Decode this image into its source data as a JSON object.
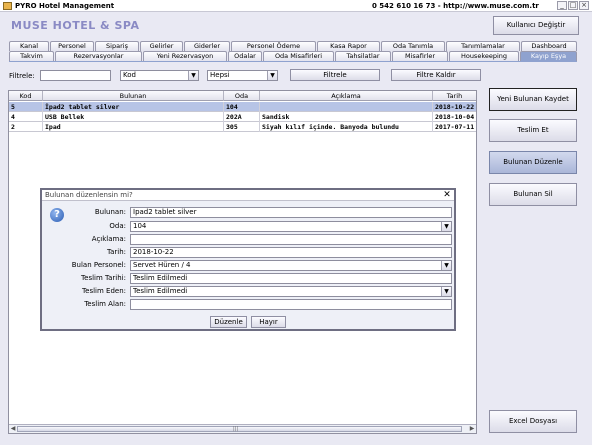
{
  "window": {
    "title": "PYRO Hotel Management",
    "contact": "0 542 610 16 73  -  http://www.muse.com.tr",
    "ctl_min": "_",
    "ctl_max": "□",
    "ctl_close": "×"
  },
  "hotel_name": "MUSE HOTEL & SPA",
  "change_user_label": "Kullanıcı Değiştir",
  "tabs_row1": [
    "Kanal",
    "Personel",
    "Sipariş",
    "Gelirler",
    "Giderler",
    "Personel Ödeme",
    "Kasa Rapor",
    "Oda Tanımla",
    "Tanımlamalar",
    "Dashboard"
  ],
  "tabs_row2": [
    "Takvim",
    "Rezervasyonlar",
    "Yeni Rezervasyon",
    "Odalar",
    "Oda Misafirleri",
    "Tahsilatlar",
    "Misafirler",
    "Housekeeping",
    "Kayıp Eşya"
  ],
  "filter": {
    "label": "Filtrele:",
    "text_value": "",
    "column_value": "Kod",
    "status_value": "Hepsi",
    "filter_button": "Filtrele",
    "clear_button": "Filtre Kaldır"
  },
  "table": {
    "headers": [
      "Kod",
      "Bulunan",
      "Oda",
      "Açıklama",
      "Tarih"
    ],
    "rows": [
      {
        "kod": "5",
        "bulunan": "İpad2 tablet silver",
        "oda": "104",
        "aciklama": "",
        "tarih": "2018-10-22 ...",
        "selected": true
      },
      {
        "kod": "4",
        "bulunan": "USB Bellek",
        "oda": "202A",
        "aciklama": "Sandisk",
        "tarih": "2018-10-04 ...",
        "selected": false
      },
      {
        "kod": "2",
        "bulunan": "Ipad",
        "oda": "305",
        "aciklama": "Siyah kılıf içinde. Banyoda bulundu",
        "tarih": "2017-07-11 ...",
        "selected": false
      }
    ],
    "scroll_left": "◀",
    "scroll_right": "▶",
    "scroll_grip": "|||"
  },
  "side_buttons": {
    "save_new": "Yeni Bulunan Kaydet",
    "deliver": "Teslim Et",
    "edit": "Bulunan Düzenle",
    "delete": "Bulunan Sil",
    "excel": "Excel Dosyası"
  },
  "dialog": {
    "title": "Bulunan düzenlensin mi?",
    "icon_glyph": "?",
    "close_glyph": "✕",
    "fields": {
      "bulunan": {
        "label": "Bulunan:",
        "value": "İpad2 tablet silver"
      },
      "oda": {
        "label": "Oda:",
        "value": "104"
      },
      "aciklama": {
        "label": "Açıklama:",
        "value": ""
      },
      "tarih": {
        "label": "Tarih:",
        "value": "2018-10-22"
      },
      "bulan_personel": {
        "label": "Bulan Personel:",
        "value": "Servet Hüren / 4"
      },
      "teslim_tarihi": {
        "label": "Teslim Tarihi:",
        "value": "Teslim Edilmedi"
      },
      "teslim_eden": {
        "label": "Teslim Eden:",
        "value": "Teslim Edilmedi"
      },
      "teslim_alan": {
        "label": "Teslim Alan:",
        "value": ""
      }
    },
    "confirm_button": "Düzenle",
    "cancel_button": "Hayır"
  },
  "icons": {
    "combo_arrow": "▼"
  }
}
